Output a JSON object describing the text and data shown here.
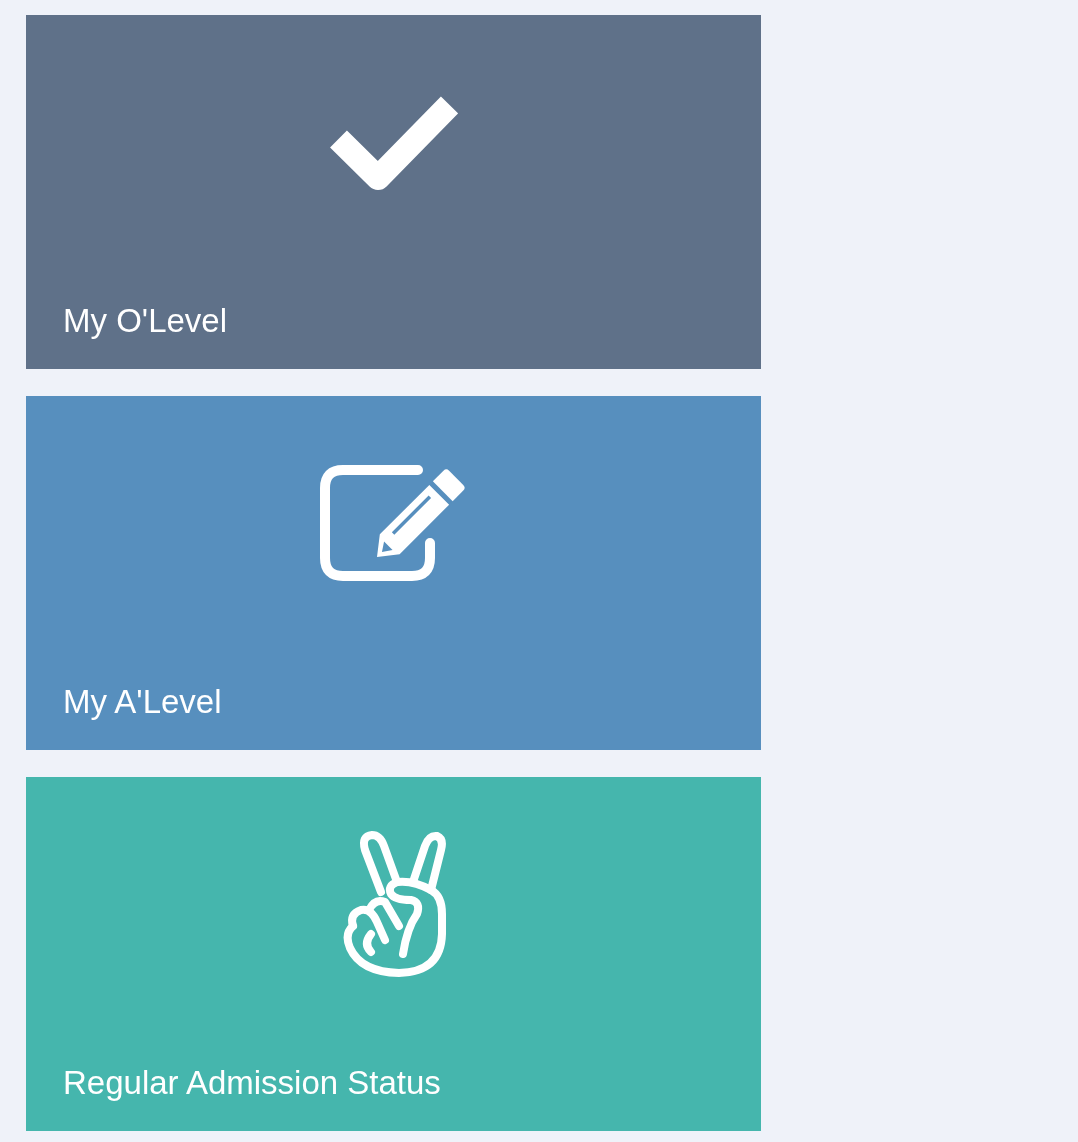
{
  "tiles": [
    {
      "kind": "check",
      "label": "My O'Level",
      "color": "#5f7189"
    },
    {
      "kind": "edit",
      "label": "My A'Level",
      "color": "#578fbe"
    },
    {
      "kind": "peace",
      "label": "Regular Admission Status",
      "color": "#45b6ad"
    }
  ]
}
